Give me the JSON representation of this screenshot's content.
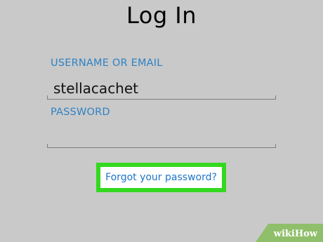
{
  "title": "Log In",
  "username": {
    "label": "USERNAME OR EMAIL",
    "value": "stellacachet"
  },
  "password": {
    "label": "PASSWORD",
    "value": ""
  },
  "forgot_password": {
    "label": "Forgot your password?",
    "highlight_color": "#34d81f"
  },
  "watermark": {
    "text": "wikiHow"
  },
  "colors": {
    "background": "#c9c9c9",
    "label_blue": "#2f82c4",
    "link_blue": "#1d74c9",
    "highlight_green": "#34d81f",
    "watermark_green": "#8fbf6a"
  }
}
